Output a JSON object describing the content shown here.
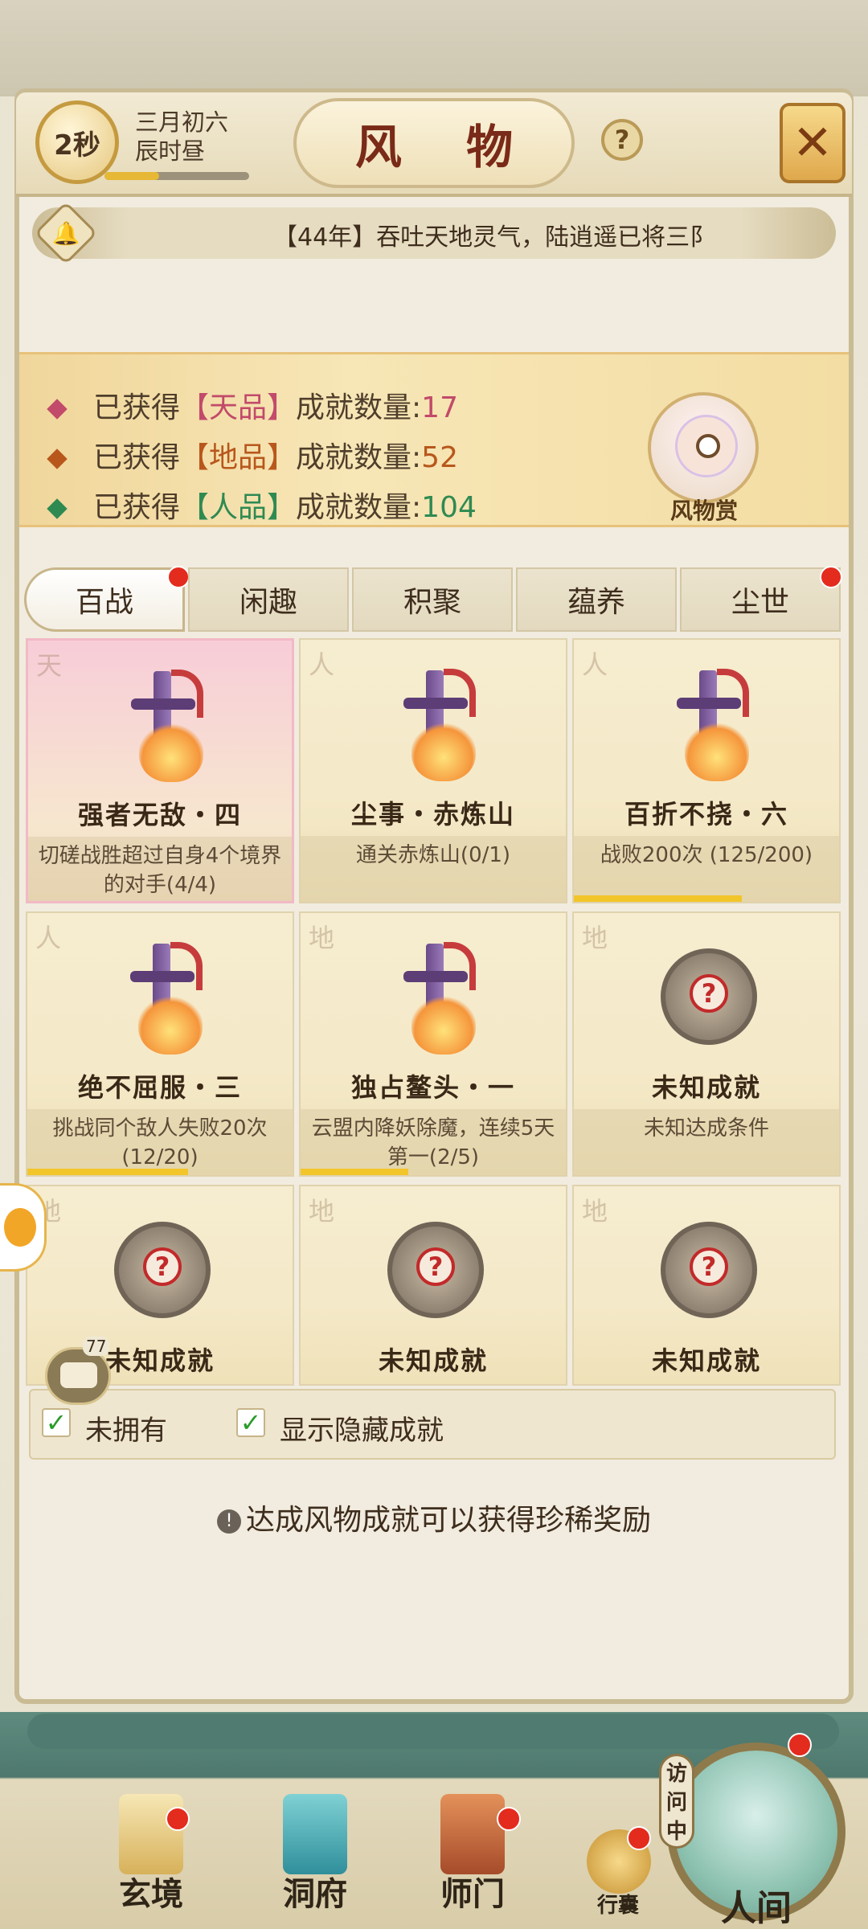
{
  "status": {
    "timer": "2秒",
    "date_line1": "三月初六",
    "date_line2": "辰时昼",
    "time_progress": 0.38
  },
  "header": {
    "title": "风 物",
    "help_label": "?",
    "close_label": "✕"
  },
  "ticker": {
    "text": "【44年】吞吐天地灵气，陆逍遥已将三阝"
  },
  "stats": {
    "rows": [
      {
        "prefix": "已获得",
        "grade": "【天品】",
        "suffix": "成就数量:",
        "value": "17",
        "color": "#c24a6a"
      },
      {
        "prefix": "已获得",
        "grade": "【地品】",
        "suffix": "成就数量:",
        "value": "52",
        "color": "#b8571c"
      },
      {
        "prefix": "已获得",
        "grade": "【人品】",
        "suffix": "成就数量:",
        "value": "104",
        "color": "#2f8a52"
      }
    ],
    "avatar_label": "风物赏"
  },
  "tabs": [
    {
      "label": "百战",
      "active": true,
      "dot": true
    },
    {
      "label": "闲趣",
      "active": false,
      "dot": false
    },
    {
      "label": "积聚",
      "active": false,
      "dot": false
    },
    {
      "label": "蕴养",
      "active": false,
      "dot": false
    },
    {
      "label": "尘世",
      "active": false,
      "dot": true
    }
  ],
  "cards": [
    {
      "grade": "天",
      "name": "强者无敌・四",
      "condition": "切磋战胜超过自身4个境界的对手(4/4)",
      "progress": 1.0,
      "icon": "sword-icon",
      "highlight": true
    },
    {
      "grade": "人",
      "name": "尘事・赤炼山",
      "condition": "通关赤炼山(0/1)",
      "progress": 0,
      "icon": "sword-icon",
      "highlight": false
    },
    {
      "grade": "人",
      "name": "百折不挠・六",
      "condition": "战败200次 (125/200)",
      "progress": 0.625,
      "icon": "sword-icon",
      "highlight": false
    },
    {
      "grade": "人",
      "name": "绝不屈服・三",
      "condition": "挑战同个敌人失败20次(12/20)",
      "progress": 0.6,
      "icon": "sword-icon",
      "highlight": false
    },
    {
      "grade": "地",
      "name": "独占鳌头・一",
      "condition": "云盟内降妖除魔，连续5天第一(2/5)",
      "progress": 0.4,
      "icon": "sword-icon",
      "highlight": false
    },
    {
      "grade": "地",
      "name": "未知成就",
      "condition": "未知达成条件",
      "progress": 0,
      "icon": "mystery-icon",
      "highlight": false
    },
    {
      "grade": "地",
      "name": "未知成就",
      "condition": "",
      "progress": 0,
      "icon": "mystery-icon",
      "highlight": false
    },
    {
      "grade": "地",
      "name": "未知成就",
      "condition": "",
      "progress": 0,
      "icon": "mystery-icon",
      "highlight": false
    },
    {
      "grade": "地",
      "name": "未知成就",
      "condition": "",
      "progress": 0,
      "icon": "mystery-icon",
      "highlight": false
    }
  ],
  "filters": {
    "not_owned": "未拥有",
    "show_hidden": "显示隐藏成就"
  },
  "chat_badge": "77",
  "hint": "达成风物成就可以获得珍稀奖励",
  "nav": {
    "xuanjing": "玄境",
    "dongfu": "洞府",
    "shimen": "师门",
    "bag": "行囊",
    "visit": "访问中",
    "world": "人间"
  }
}
